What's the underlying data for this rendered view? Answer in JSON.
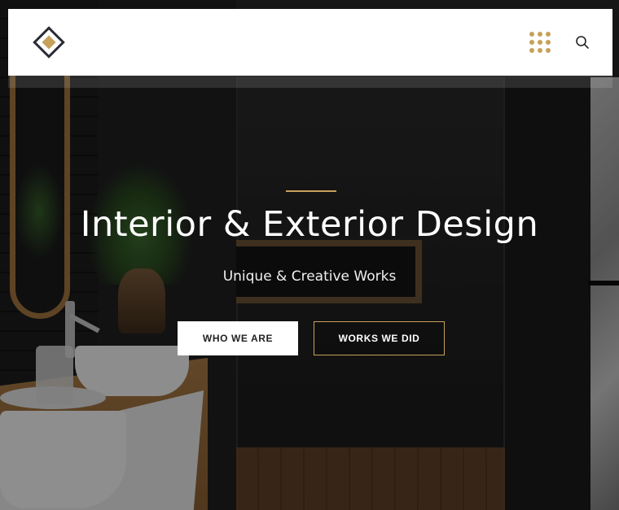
{
  "header": {
    "logo_icon": "diamond-logo-icon",
    "menu_icon": "dots-grid-icon",
    "search_icon": "search-icon",
    "accent_color": "#c7a15a"
  },
  "hero": {
    "title": "Interior & Exterior Design",
    "subtitle": "Unique & Creative Works",
    "primary_button": "WHO WE ARE",
    "secondary_button": "WORKS WE DID"
  }
}
